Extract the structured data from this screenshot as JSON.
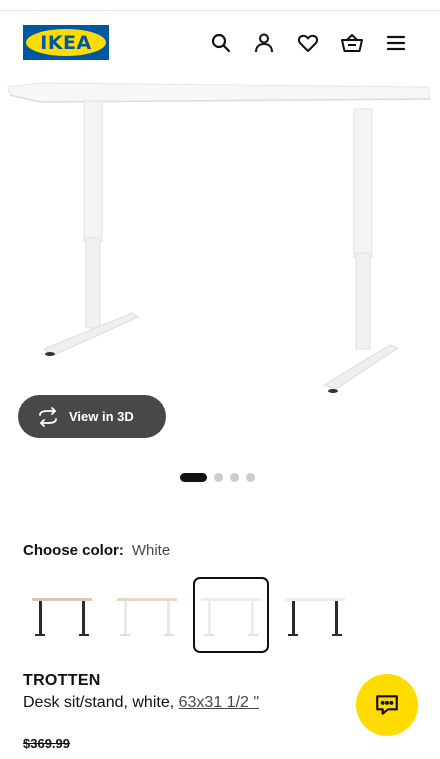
{
  "header": {
    "logo_text": "IKEA",
    "icons": [
      "search-icon",
      "account-icon",
      "heart-icon",
      "basket-icon",
      "menu-icon"
    ]
  },
  "gallery": {
    "view_3d_label": "View in 3D",
    "image_count": 4,
    "active_index": 0
  },
  "color": {
    "label": "Choose color:",
    "value": "White",
    "swatches": [
      "beige",
      "white-beige",
      "white",
      "black-white"
    ],
    "selected_index": 2
  },
  "product": {
    "name": "TROTTEN",
    "description": "Desk sit/stand, white, ",
    "size": "63x31 1/2 \"",
    "old_price": "$369.99"
  },
  "colors": {
    "brand_blue": "#0058a3",
    "brand_yellow": "#ffdb00",
    "button_dark": "#484848"
  }
}
